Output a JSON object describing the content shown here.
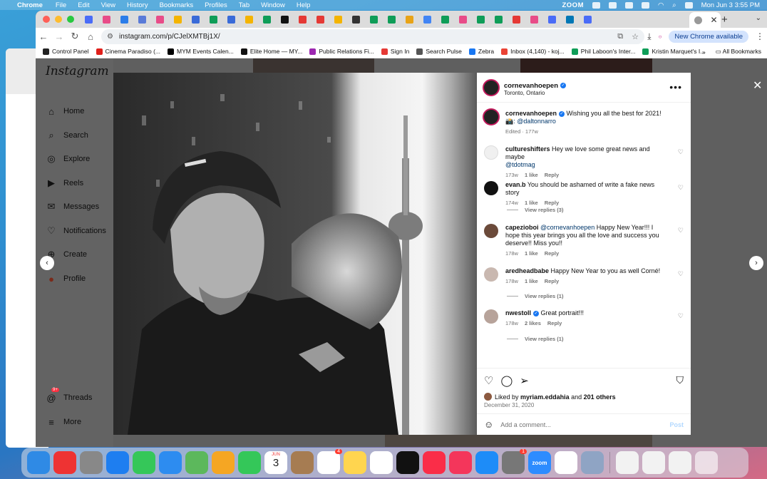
{
  "menubar": {
    "app": "Chrome",
    "items": [
      "File",
      "Edit",
      "View",
      "History",
      "Bookmarks",
      "Profiles",
      "Tab",
      "Window",
      "Help"
    ],
    "zoom_label": "ZOOM",
    "datetime": "Mon Jun 3  3:55 PM"
  },
  "browser": {
    "url": "instagram.com/p/CJelXMTBj1X/",
    "new_chrome": "New Chrome available",
    "bookmarks": [
      {
        "label": "Control Panel",
        "color": "#222"
      },
      {
        "label": "Cinema Paradiso (...",
        "color": "#e0201b"
      },
      {
        "label": "MYM Events Calen...",
        "color": "#000"
      },
      {
        "label": "Elite Home — MY...",
        "color": "#111"
      },
      {
        "label": "Public Relations Fi...",
        "color": "#9c27b0"
      },
      {
        "label": "Sign In",
        "color": "#e53935"
      },
      {
        "label": "Search Pulse",
        "color": "#555"
      },
      {
        "label": "Zebra",
        "color": "#1877f2"
      },
      {
        "label": "Inbox (4,140) - koj...",
        "color": "#ea4335"
      },
      {
        "label": "Phil Laboon's Inter...",
        "color": "#0f9d58"
      },
      {
        "label": "Kristin Marquet's I...",
        "color": "#0f9d58"
      }
    ],
    "all_bookmarks": "All Bookmarks"
  },
  "instagram": {
    "logo": "Instagram",
    "nav": [
      {
        "label": "Home",
        "icon": "home-icon"
      },
      {
        "label": "Search",
        "icon": "search-icon"
      },
      {
        "label": "Explore",
        "icon": "explore-icon"
      },
      {
        "label": "Reels",
        "icon": "reels-icon"
      },
      {
        "label": "Messages",
        "icon": "messages-icon"
      },
      {
        "label": "Notifications",
        "icon": "heart-icon"
      },
      {
        "label": "Create",
        "icon": "plus-icon"
      },
      {
        "label": "Profile",
        "icon": "profile-icon"
      }
    ],
    "threads": "Threads",
    "threads_badge": "9+",
    "more": "More"
  },
  "post": {
    "author": "cornevanhoepen",
    "location": "Toronto, Ontario",
    "caption": "Wishing you all the best for 2021!",
    "caption_credit": "📸: @daltonnarro",
    "edited": "Edited · 177w",
    "comments": [
      {
        "user": "cultureshifters",
        "text": "Hey we love some great news and maybe",
        "mention": "@tdotmag",
        "age": "173w",
        "likes": "1 like",
        "reply": "Reply",
        "replies": ""
      },
      {
        "user": "evan.b",
        "text": "You should be ashamed of write a fake news story",
        "mention": "",
        "age": "174w",
        "likes": "1 like",
        "reply": "Reply",
        "replies": "View replies (3)"
      },
      {
        "user": "capezioboi",
        "text": "Happy New Year!!! I hope this year brings you all the love and success you deserve!! Miss you!!",
        "mention": "@cornevanhoepen",
        "age": "178w",
        "likes": "1 like",
        "reply": "Reply",
        "replies": ""
      },
      {
        "user": "aredheadbabe",
        "text": "Happy New Year to you as well Corné!",
        "mention": "",
        "age": "178w",
        "likes": "1 like",
        "reply": "Reply",
        "replies": "View replies (1)"
      },
      {
        "user": "nwestoll",
        "text": "Great portrait!!!",
        "mention": "",
        "age": "178w",
        "likes": "2 likes",
        "reply": "Reply",
        "replies": "View replies (1)"
      }
    ],
    "liked_by_prefix": "Liked by",
    "liked_by_user": "myriam.eddahia",
    "liked_by_and": "and",
    "liked_by_others": "201 others",
    "date": "December 31, 2020",
    "add_comment_placeholder": "Add a comment...",
    "post_button": "Post"
  },
  "dock": {
    "calendar_month": "JUN",
    "calendar_day": "3",
    "mail_badge": "4",
    "zoom_label": "zoom",
    "settings_badge": "1"
  }
}
